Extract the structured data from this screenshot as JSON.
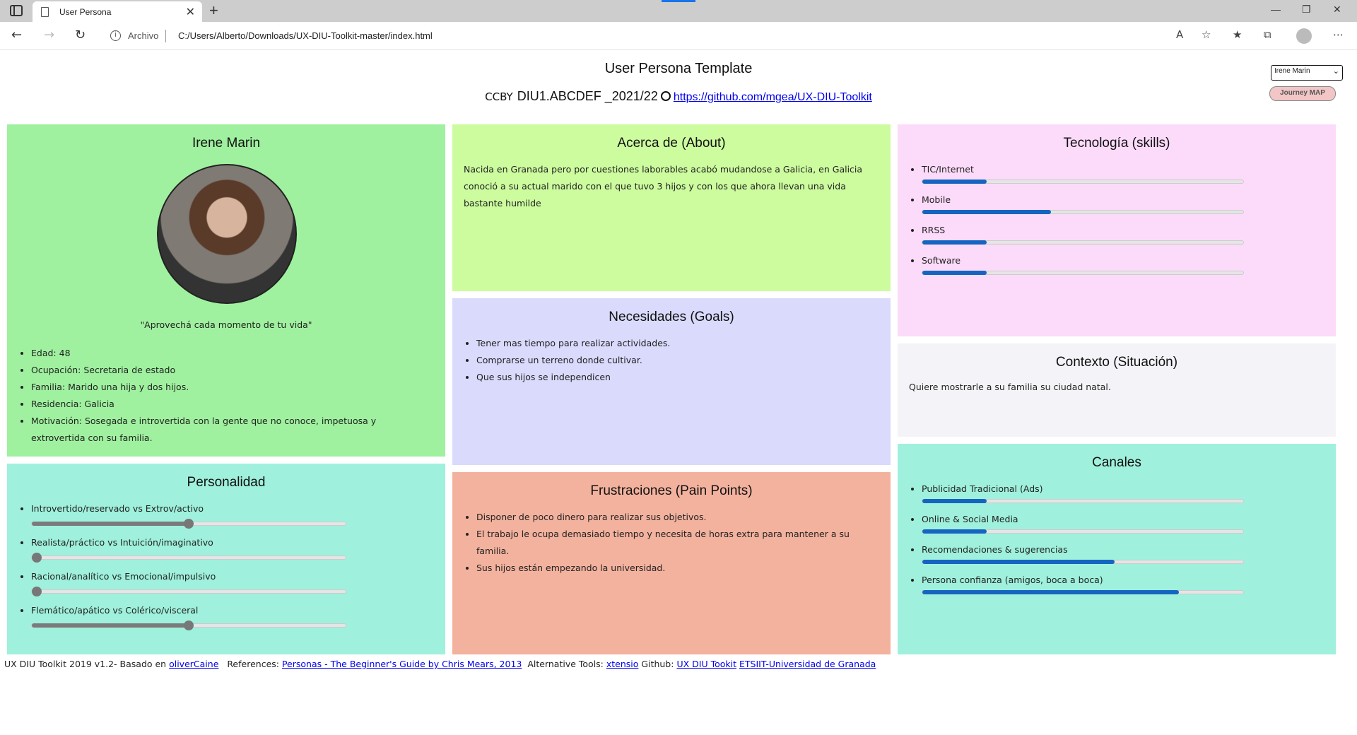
{
  "browser": {
    "tab_title": "User Persona",
    "address_label": "Archivo",
    "url": "C:/Users/Alberto/Downloads/UX-DIU-Toolkit-master/index.html"
  },
  "header": {
    "title": "User Persona Template",
    "ccby": "CCBY",
    "course": "DIU1.ABCDEF _2021/22",
    "repo_link": "https://github.com/mgea/UX-DIU-Toolkit"
  },
  "controls": {
    "persona_selected": "Irene Marin",
    "journey_button": "Journey MAP"
  },
  "profile": {
    "name": "Irene Marin",
    "quote": "\"Aprovechá cada momento de tu vida\"",
    "details": [
      "Edad: 48",
      "Ocupación: Secretaria de estado",
      "Familia: Marido una hija y dos hijos.",
      "Residencia: Galicia",
      "Motivación: Sosegada e introvertida con la gente que no conoce, impetuosa y extrovertida con su familia."
    ]
  },
  "about": {
    "title": "Acerca de (About)",
    "text": "Nacida en Granada pero por cuestiones laborables acabó mudandose a Galicia, en Galicia conoció a su actual marido con el que tuvo 3 hijos y con los que ahora llevan una vida bastante humilde"
  },
  "goals": {
    "title": "Necesidades (Goals)",
    "items": [
      "Tener mas tiempo para realizar actividades.",
      "Comprarse un terreno donde cultivar.",
      "Que sus hijos se independicen"
    ]
  },
  "pains": {
    "title": "Frustraciones (Pain Points)",
    "items": [
      "Disponer de poco dinero para realizar sus objetivos.",
      "El trabajo le ocupa demasiado tiempo y necesita de horas extra para mantener a su familia.",
      "Sus hijos están empezando la universidad."
    ]
  },
  "skills": {
    "title": "Tecnología (skills)",
    "items": [
      {
        "label": "TIC/Internet",
        "value": 0.2
      },
      {
        "label": "Mobile",
        "value": 0.4
      },
      {
        "label": "RRSS",
        "value": 0.2
      },
      {
        "label": "Software",
        "value": 0.2
      }
    ]
  },
  "context": {
    "title": "Contexto (Situación)",
    "text": "Quiere mostrarle a su familia su ciudad natal."
  },
  "channels": {
    "title": "Canales",
    "items": [
      {
        "label": "Publicidad Tradicional (Ads)",
        "value": 0.2
      },
      {
        "label": "Online & Social Media",
        "value": 0.2
      },
      {
        "label": "Recomendaciones & sugerencias",
        "value": 0.6
      },
      {
        "label": "Persona confianza (amigos, boca a boca)",
        "value": 0.8
      }
    ]
  },
  "personality": {
    "title": "Personalidad",
    "items": [
      {
        "label": "Introvertido/reservado vs Extrov/activo",
        "value": 0.5
      },
      {
        "label": "Realista/práctico vs Intuición/imaginativo",
        "value": 0.0
      },
      {
        "label": "Racional/analítico vs Emocional/impulsivo",
        "value": 0.0
      },
      {
        "label": "Flemático/apático vs Colérico/visceral",
        "value": 0.5
      }
    ]
  },
  "footer": {
    "prefix": "UX DIU Toolkit 2019 v1.2- Basado en",
    "link1": "oliverCaine",
    "references_label": "References:",
    "link2": "Personas - The Beginner's Guide by Chris Mears, 2013",
    "alt_label": "Alternative Tools:",
    "link3": "xtensio",
    "github_label": "Github:",
    "link4": "UX DIU Tookit",
    "link5": "ETSIIT-Universidad de Granada"
  },
  "colors": {
    "profile_bg": "#9ff19f",
    "about_bg": "#ccfc9e",
    "goals_bg": "#dadafc",
    "pains_bg": "#f3b29e",
    "skills_bg": "#fcdbfa",
    "context_bg": "#f4f4f8",
    "channels_bg": "#9ff0dc",
    "personality_bg": "#9ff0dc",
    "bar_fill": "#1565c0"
  }
}
